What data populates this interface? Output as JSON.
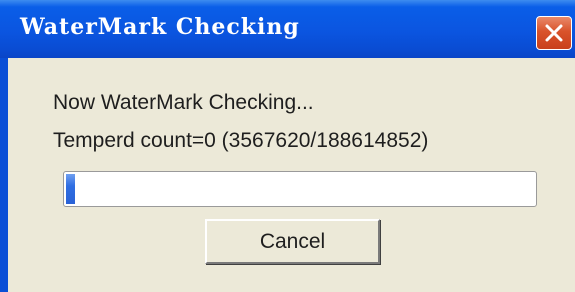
{
  "window": {
    "title": "WaterMark Checking"
  },
  "dialog": {
    "status_line": "Now WaterMark Checking...",
    "count_line": "Temperd count=0 (3567620/188614852)",
    "progress_fraction": 0.0189,
    "cancel_label": "Cancel"
  },
  "icons": {
    "close": "close-icon"
  },
  "colors": {
    "titlebar": "#0a55e0",
    "close_button": "#d9532b",
    "dialog_background": "#ece9d8",
    "progress_fill": "#2f6ee2"
  }
}
